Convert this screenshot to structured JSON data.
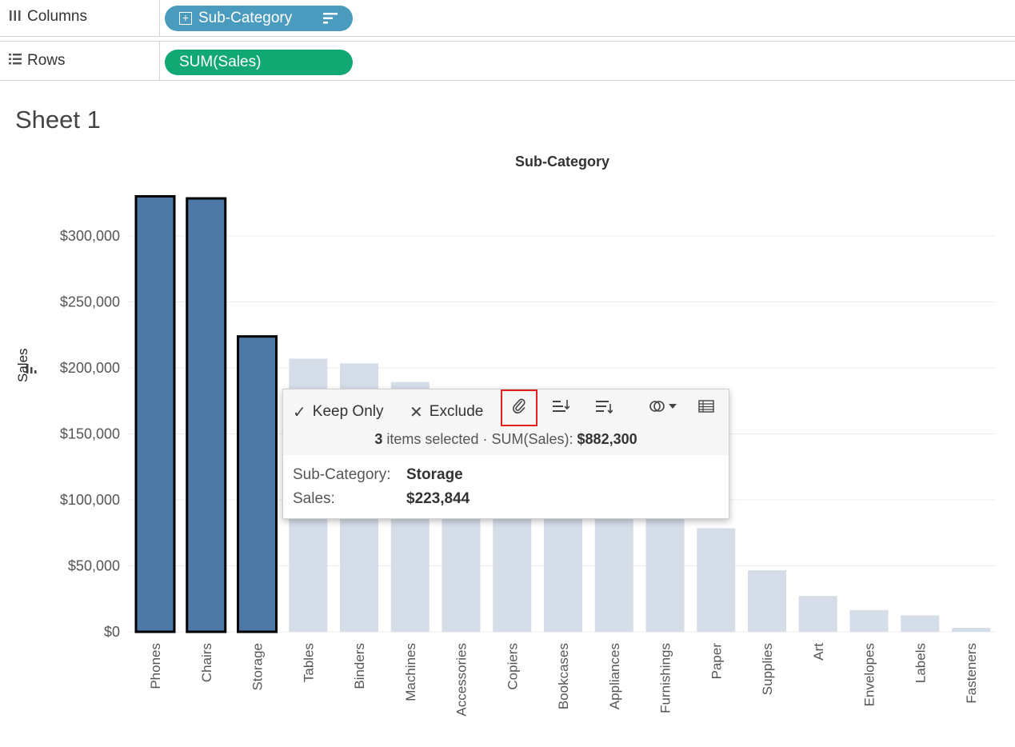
{
  "shelves": {
    "columns": {
      "label": "Columns",
      "pill": "Sub-Category"
    },
    "rows": {
      "label": "Rows",
      "pill": "SUM(Sales)"
    }
  },
  "sheet": {
    "title": "Sheet 1"
  },
  "chart_data": {
    "type": "bar",
    "title": "Sub-Category",
    "xlabel": "",
    "ylabel": "Sales",
    "ylim": [
      0,
      330000
    ],
    "yticks": [
      {
        "value": 0,
        "label": "$0"
      },
      {
        "value": 50000,
        "label": "$50,000"
      },
      {
        "value": 100000,
        "label": "$100,000"
      },
      {
        "value": 150000,
        "label": "$150,000"
      },
      {
        "value": 200000,
        "label": "$200,000"
      },
      {
        "value": 250000,
        "label": "$250,000"
      },
      {
        "value": 300000,
        "label": "$300,000"
      }
    ],
    "grid": true,
    "categories": [
      "Phones",
      "Chairs",
      "Storage",
      "Tables",
      "Binders",
      "Machines",
      "Accessories",
      "Copiers",
      "Bookcases",
      "Appliances",
      "Furnishings",
      "Paper",
      "Supplies",
      "Art",
      "Envelopes",
      "Labels",
      "Fasteners"
    ],
    "values": [
      330007,
      328449,
      223844,
      206966,
      203413,
      189239,
      167380,
      149528,
      114880,
      107532,
      91705,
      78479,
      46674,
      27119,
      16476,
      12486,
      3024
    ],
    "selected": [
      "Phones",
      "Chairs",
      "Storage"
    ],
    "colors": {
      "selected": "#4e79a7",
      "selected_border": "#000000",
      "unselected": "#d4dde8"
    }
  },
  "tooltip": {
    "keep_only": "Keep Only",
    "exclude": "Exclude",
    "count": "3",
    "items_selected": "items selected",
    "separator": "·",
    "sum_label": "SUM(Sales):",
    "sum_value": "$882,300",
    "field1_label": "Sub-Category:",
    "field1_value": "Storage",
    "field2_label": "Sales:",
    "field2_value": "$223,844"
  },
  "icons": {
    "columns": "columns-icon",
    "rows": "rows-icon",
    "group": "paperclip-icon",
    "sort_asc": "sort-ascending-icon",
    "sort_desc": "sort-descending-icon",
    "sets": "sets-icon",
    "view_data": "view-data-icon"
  }
}
